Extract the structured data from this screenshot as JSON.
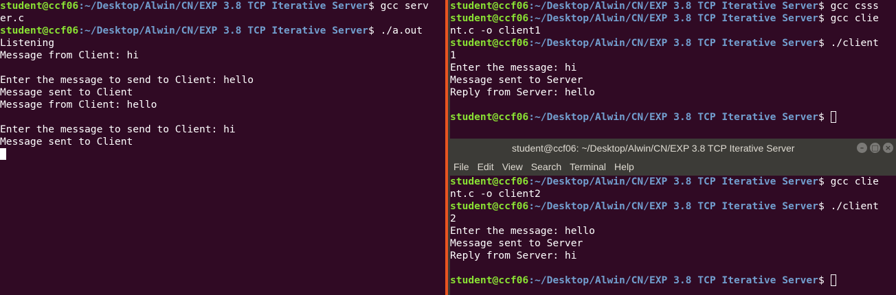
{
  "prompt_user": "student@ccf06",
  "prompt_path": ":~/Desktop/Alwin/CN/EXP 3.8 TCP Iterative Server",
  "prompt_symbol": "$",
  "left_terminal": {
    "lines": [
      {
        "type": "prompt",
        "cmd": " gcc serv"
      },
      {
        "type": "text",
        "text": "er.c"
      },
      {
        "type": "prompt",
        "cmd": " ./a.out"
      },
      {
        "type": "text",
        "text": "Listening"
      },
      {
        "type": "text",
        "text": "Message from Client: hi"
      },
      {
        "type": "text",
        "text": ""
      },
      {
        "type": "text",
        "text": "Enter the message to send to Client: hello"
      },
      {
        "type": "text",
        "text": "Message sent to Client"
      },
      {
        "type": "text",
        "text": "Message from Client: hello"
      },
      {
        "type": "text",
        "text": ""
      },
      {
        "type": "text",
        "text": "Enter the message to send to Client: hi"
      },
      {
        "type": "text",
        "text": "Message sent to Client"
      },
      {
        "type": "cursor"
      }
    ]
  },
  "right_top_terminal": {
    "lines": [
      {
        "type": "prompt",
        "cmd": " gcc csss"
      },
      {
        "type": "prompt",
        "cmd": " gcc clie"
      },
      {
        "type": "text",
        "text": "nt.c -o client1"
      },
      {
        "type": "prompt",
        "cmd": " ./client"
      },
      {
        "type": "text",
        "text": "1"
      },
      {
        "type": "text",
        "text": "Enter the message: hi"
      },
      {
        "type": "text",
        "text": "Message sent to Server"
      },
      {
        "type": "text",
        "text": "Reply from Server: hello"
      },
      {
        "type": "text",
        "text": ""
      },
      {
        "type": "prompt",
        "cmd": " ",
        "cursor": true
      }
    ]
  },
  "right_bottom_window": {
    "title": "student@ccf06: ~/Desktop/Alwin/CN/EXP 3.8 TCP Iterative Server",
    "controls": {
      "minimize": "–",
      "maximize": "□",
      "close": "×"
    },
    "menu": [
      "File",
      "Edit",
      "View",
      "Search",
      "Terminal",
      "Help"
    ],
    "lines": [
      {
        "type": "prompt",
        "cmd": " gcc clie"
      },
      {
        "type": "text",
        "text": "nt.c -o client2"
      },
      {
        "type": "prompt",
        "cmd": " ./client"
      },
      {
        "type": "text",
        "text": "2"
      },
      {
        "type": "text",
        "text": "Enter the message: hello"
      },
      {
        "type": "text",
        "text": "Message sent to Server"
      },
      {
        "type": "text",
        "text": "Reply from Server: hi"
      },
      {
        "type": "text",
        "text": ""
      },
      {
        "type": "prompt",
        "cmd": " ",
        "cursor": true
      }
    ]
  },
  "colors": {
    "terminal_bg": "#300a24",
    "prompt_user": "#8ae234",
    "prompt_path": "#729fcf",
    "accent": "#e95420",
    "titlebar_bg": "#3c3b37"
  }
}
